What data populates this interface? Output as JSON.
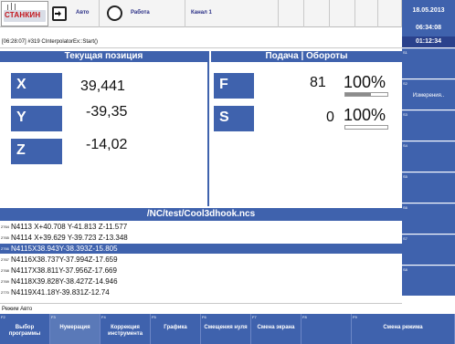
{
  "header": {
    "logo_text": "СТАНКИН",
    "mode_label": "Авто",
    "state_label": "Работа",
    "channel_label": "Канал 1",
    "date": "18.05.2013",
    "time": "06:34:08",
    "elapsed": "01:12:34"
  },
  "message": "[06:28:07] #319 CInterpolatorEx::Start()",
  "position_panel": {
    "title": "Текущая позиция",
    "axes": [
      {
        "name": "X",
        "value": "39,441"
      },
      {
        "name": "Y",
        "value": "-39,35"
      },
      {
        "name": "Z",
        "value": "-14,02"
      }
    ]
  },
  "feed_panel": {
    "title": "Подача | Обороты",
    "rows": [
      {
        "name": "F",
        "value": "81",
        "override": "100%",
        "level": 0.6
      },
      {
        "name": "S",
        "value": "0",
        "override": "100%",
        "level": 0.0
      }
    ]
  },
  "program": {
    "path": "/NC/test/Cool3dhook.ncs",
    "lines": [
      {
        "num": "2764",
        "text": "N4113 X+40.708 Y-41.813 Z-11.577",
        "selected": false
      },
      {
        "num": "2765",
        "text": "N4114 X+39.629 Y-39.723 Z-13.348",
        "selected": false
      },
      {
        "num": "2766",
        "text": "N4115X38.943Y-38.393Z-15.805",
        "selected": true
      },
      {
        "num": "2767",
        "text": "N4116X38.737Y-37.994Z-17.659",
        "selected": false
      },
      {
        "num": "2768",
        "text": "N4117X38.811Y-37.956Z-17.669",
        "selected": false
      },
      {
        "num": "2769",
        "text": "N4118X39.828Y-38.427Z-14.946",
        "selected": false
      },
      {
        "num": "2770",
        "text": "N4119X41.18Y-39.831Z-12.74",
        "selected": false
      }
    ]
  },
  "mode_line": "Режим Авто",
  "right_keys": [
    {
      "num": "S1",
      "label": ""
    },
    {
      "num": "S2",
      "label": "Измерения.."
    },
    {
      "num": "S3",
      "label": ""
    },
    {
      "num": "S4",
      "label": ""
    },
    {
      "num": "S5",
      "label": ""
    },
    {
      "num": "S6",
      "label": ""
    },
    {
      "num": "S7",
      "label": ""
    },
    {
      "num": "S8",
      "label": ""
    }
  ],
  "bottom_keys": [
    {
      "num": "F2",
      "label": "Выбор программы"
    },
    {
      "num": "F3",
      "label": "Нумерация"
    },
    {
      "num": "F4",
      "label": "Коррекция инструмента"
    },
    {
      "num": "F5",
      "label": "Графика"
    },
    {
      "num": "F6",
      "label": "Смещения нуля"
    },
    {
      "num": "F7",
      "label": "Смена экрана"
    },
    {
      "num": "F8",
      "label": ""
    },
    {
      "num": "F9",
      "label": "Смена режима"
    }
  ],
  "colors": {
    "accent": "#3f62ad",
    "accent_dark": "#2a418c",
    "highlight": "#5a79b8"
  },
  "icons": {
    "mode": "arrow-into-box-icon",
    "state": "circle-icon"
  }
}
